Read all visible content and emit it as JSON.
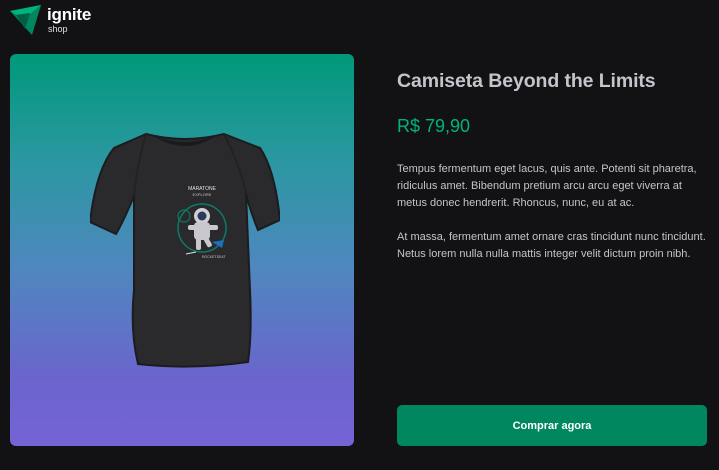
{
  "brand": {
    "name": "ignite",
    "sub": "shop",
    "icon": "ignite-logo-icon"
  },
  "product": {
    "image_icon": "tshirt-astronaut-image",
    "title": "Camiseta Beyond the Limits",
    "price": "R$ 79,90",
    "description": "Tempus fermentum eget lacus, quis ante. Potenti sit pharetra, ridiculus amet. Bibendum pretium arcu arcu eget viverra at metus donec hendrerit. Rhoncus, nunc, eu at ac.\n\nAt massa, fermentum amet ornare cras tincidunt nunc tincidunt. Netus lorem nulla nulla mattis integer velit dictum proin nibh.",
    "buy_label": "Comprar agora"
  },
  "colors": {
    "background": "#121214",
    "accent": "#00875f",
    "price": "#00b37e",
    "gradient_top": "#00997a",
    "gradient_bottom": "#7464d6"
  }
}
